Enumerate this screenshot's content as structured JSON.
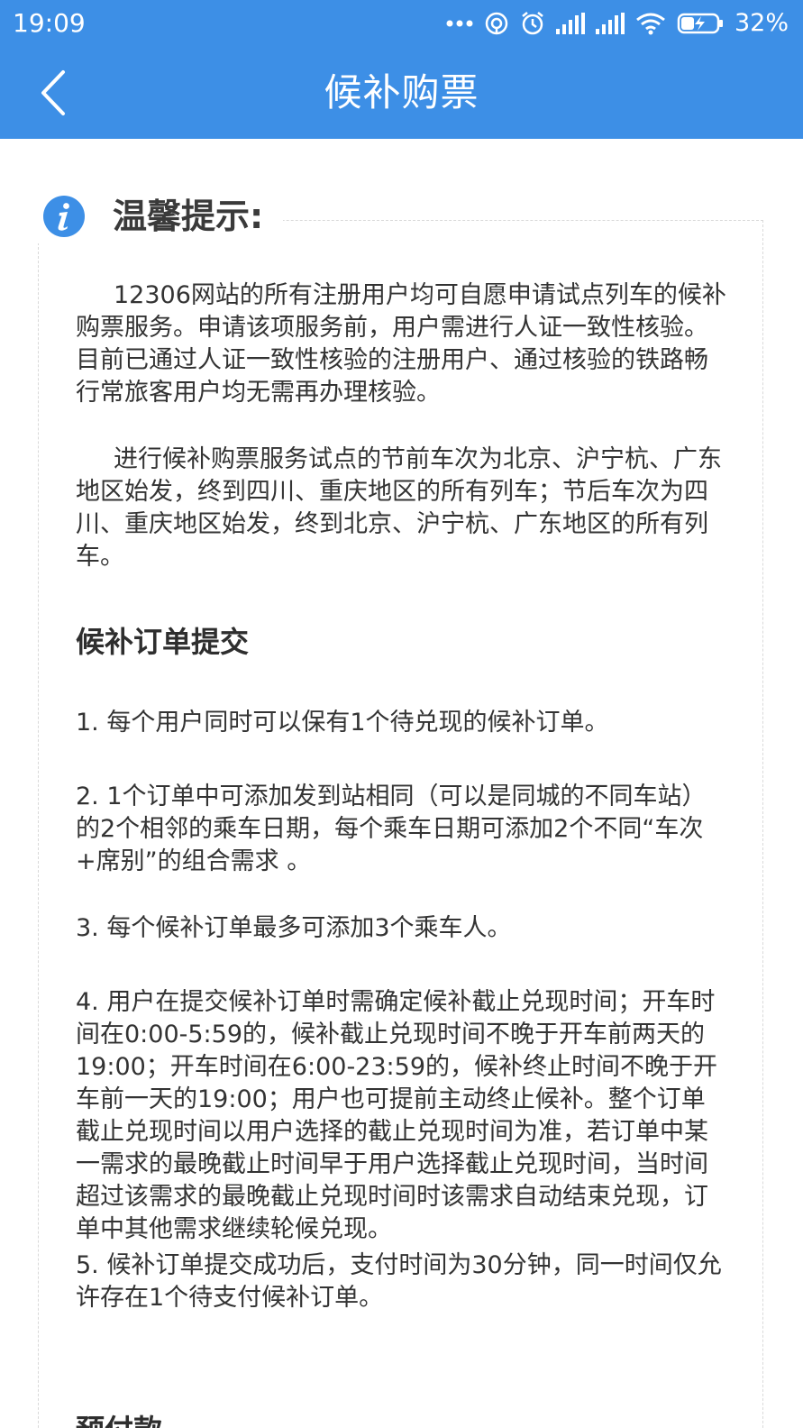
{
  "status_bar": {
    "time": "19:09",
    "battery_percent": "32%",
    "icons": [
      "more-dots-icon",
      "hotspot-icon",
      "alarm-icon",
      "signal-icon",
      "signal-icon",
      "wifi-icon",
      "battery-charging-icon"
    ]
  },
  "header": {
    "title": "候补购票",
    "back_icon": "chevron-left-icon"
  },
  "tip": {
    "title": "温馨提示:",
    "icon": "info-icon",
    "paragraphs": [
      "12306网站的所有注册用户均可自愿申请试点列车的候补购票服务。申请该项服务前，用户需进行人证一致性核验。目前已通过人证一致性核验的注册用户、通过核验的铁路畅行常旅客用户均无需再办理核验。",
      "进行候补购票服务试点的节前车次为北京、沪宁杭、广东地区始发，终到四川、重庆地区的所有列车；节后车次为四川、重庆地区始发，终到北京、沪宁杭、广东地区的所有列车。"
    ]
  },
  "sections": [
    {
      "title": "候补订单提交",
      "items": [
        "1. 每个用户同时可以保有1个待兑现的候补订单。",
        "2. 1个订单中可添加发到站相同（可以是同城的不同车站）的2个相邻的乘车日期，每个乘车日期可添加2个不同“车次+席别”的组合需求 。",
        "3. 每个候补订单最多可添加3个乘车人。",
        "4. 用户在提交候补订单时需确定候补截止兑现时间；开车时间在0:00-5:59的，候补截止兑现时间不晚于开车前两天的19:00；开车时间在6:00-23:59的，候补终止时间不晚于开车前一天的19:00；用户也可提前主动终止候补。整个订单截止兑现时间以用户选择的截止兑现时间为准，若订单中某一需求的最晚截止时间早于用户选择截止兑现时间，当时间超过该需求的最晚截止兑现时间时该需求自动结束兑现，订单中其他需求继续轮候兑现。",
        "5. 候补订单提交成功后，支付时间为30分钟，同一时间仅允许存在1个待支付候补订单。"
      ]
    },
    {
      "title": "预付款"
    }
  ],
  "colors": {
    "brand_blue": "#3d8fe6",
    "info_icon_blue": "#3d8fe6",
    "text": "#333333",
    "dashed_border": "#d9d9d9"
  }
}
